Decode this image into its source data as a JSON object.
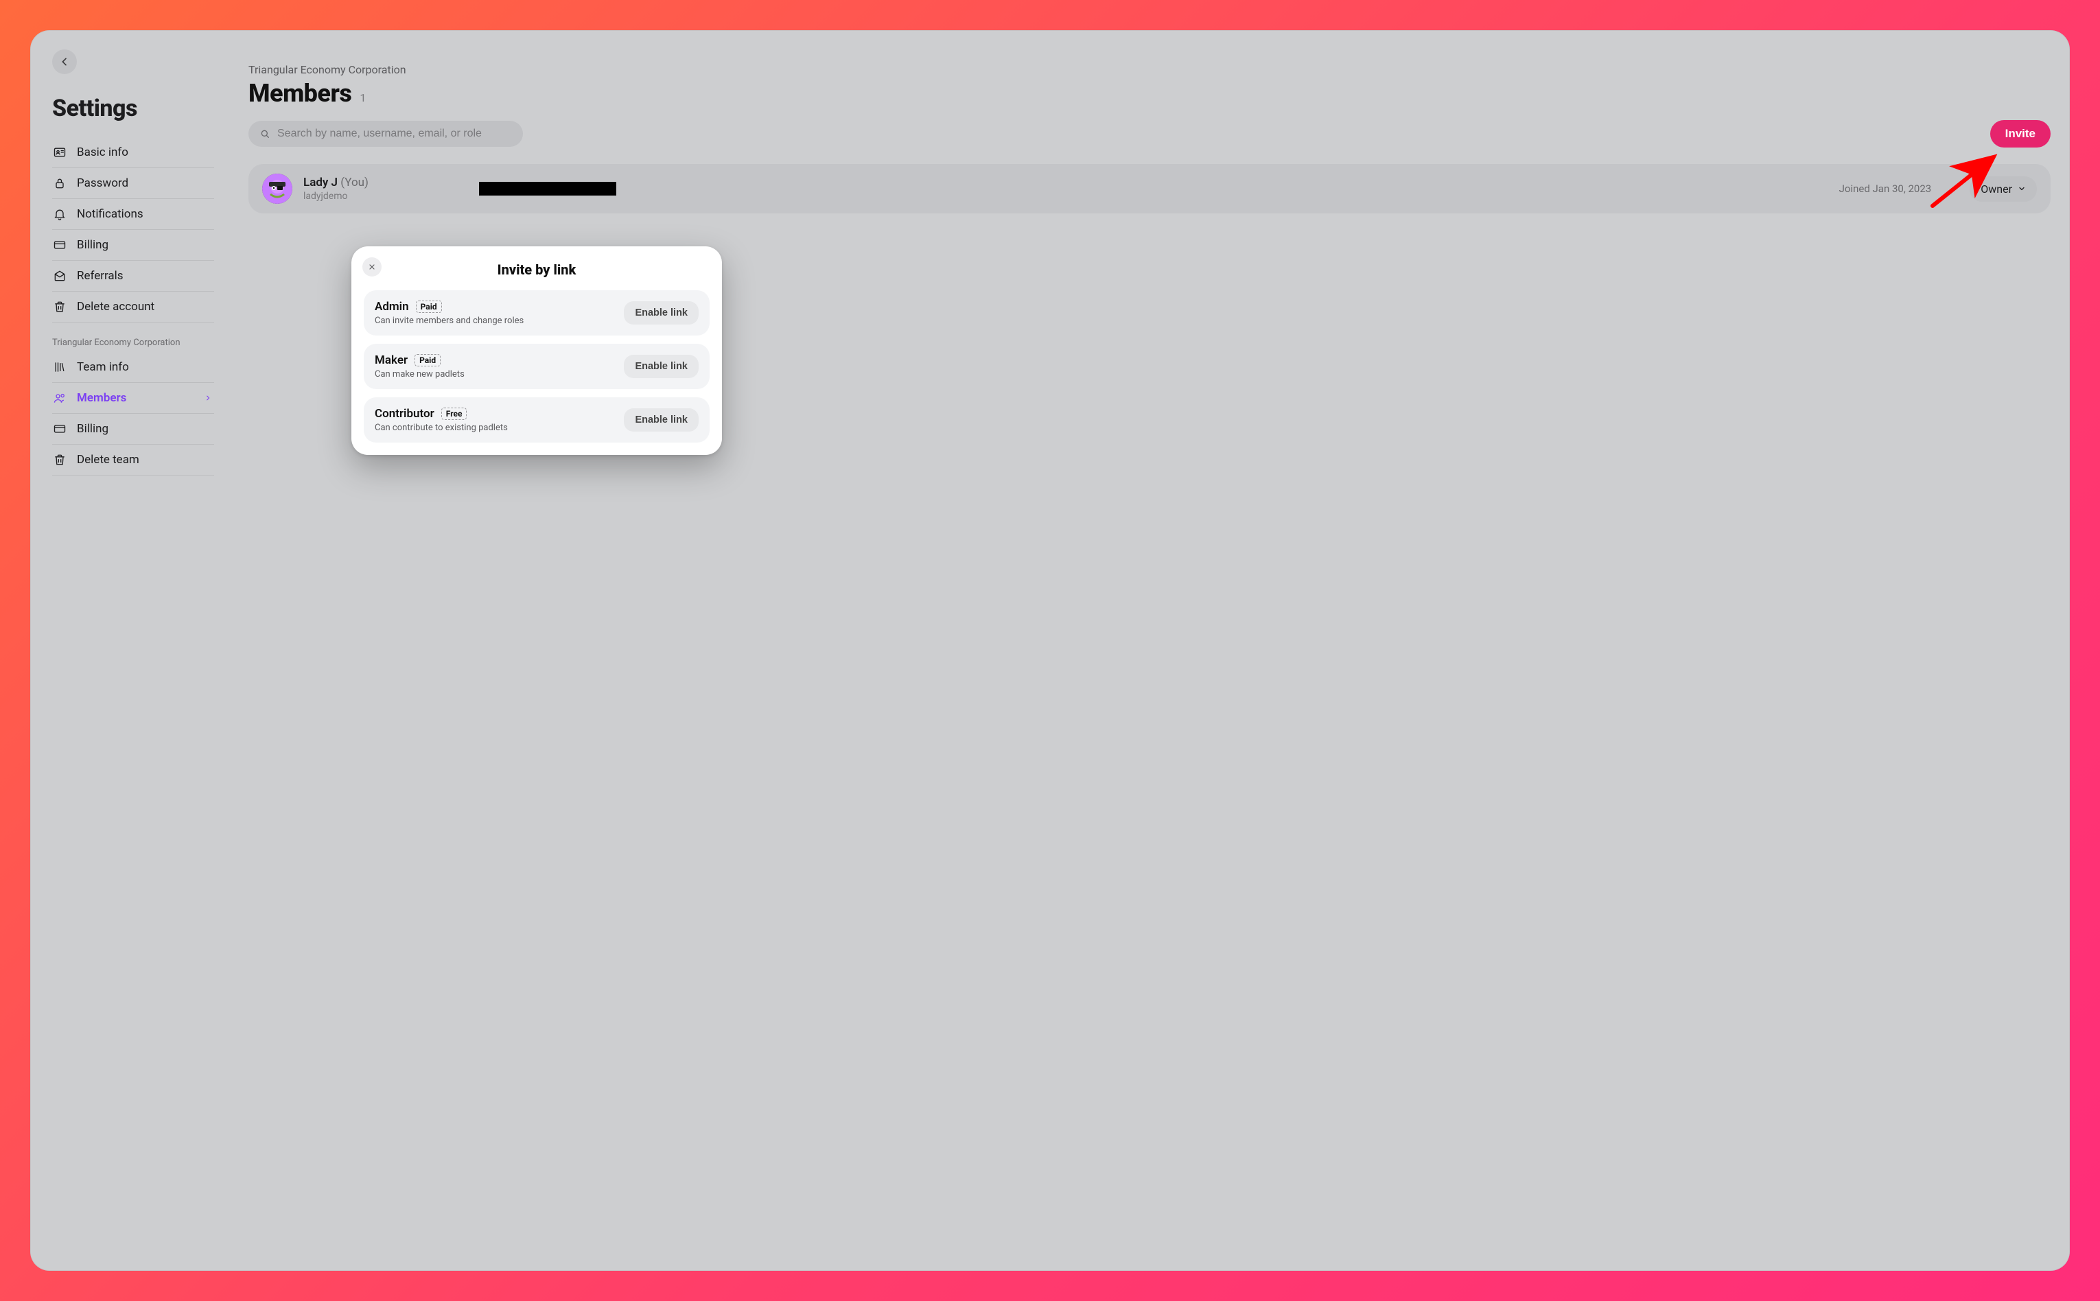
{
  "sidebar": {
    "title": "Settings",
    "personal_items": [
      {
        "icon": "id-card",
        "label": "Basic info"
      },
      {
        "icon": "lock",
        "label": "Password"
      },
      {
        "icon": "bell",
        "label": "Notifications"
      },
      {
        "icon": "card",
        "label": "Billing"
      },
      {
        "icon": "envelope-open",
        "label": "Referrals"
      },
      {
        "icon": "trash",
        "label": "Delete account"
      }
    ],
    "team_section_label": "Triangular Economy Corporation",
    "team_items": [
      {
        "icon": "books",
        "label": "Team info",
        "active": false
      },
      {
        "icon": "people",
        "label": "Members",
        "active": true
      },
      {
        "icon": "card",
        "label": "Billing",
        "active": false
      },
      {
        "icon": "trash",
        "label": "Delete team",
        "active": false
      }
    ]
  },
  "header": {
    "org_name": "Triangular Economy Corporation",
    "page_title": "Members",
    "member_count": "1"
  },
  "search": {
    "placeholder": "Search by name, username, email, or role"
  },
  "invite_button_label": "Invite",
  "members": [
    {
      "display_name": "Lady J",
      "you_suffix": "(You)",
      "username": "ladyjdemo",
      "joined_text": "Joined Jan 30, 2023",
      "role": "Owner"
    }
  ],
  "modal": {
    "title": "Invite by link",
    "options": [
      {
        "role": "Admin",
        "tier": "Paid",
        "desc": "Can invite members and change roles",
        "button": "Enable link"
      },
      {
        "role": "Maker",
        "tier": "Paid",
        "desc": "Can make new padlets",
        "button": "Enable link"
      },
      {
        "role": "Contributor",
        "tier": "Free",
        "desc": "Can contribute to existing padlets",
        "button": "Enable link"
      }
    ]
  }
}
